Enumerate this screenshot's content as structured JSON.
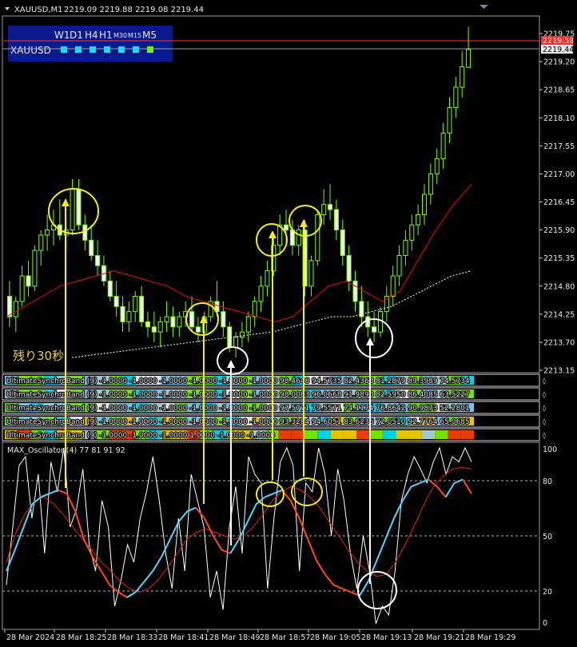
{
  "header": {
    "symbol_title": "XAUUSD,M1",
    "ohlc": "2219.09 2219.88 2219.08 2219.44"
  },
  "panel": {
    "timeframes": [
      "W1",
      "D1",
      "H4",
      "H1",
      "M30",
      "M15",
      "M5"
    ],
    "symbol": "XAUUSD",
    "squares": [
      "#00e5ff",
      "#00e5ff",
      "#00e5ff",
      "#00e5ff",
      "#00e5ff",
      "#00e5ff",
      "#66ff00"
    ]
  },
  "remaining_label": "残り30秒",
  "colors": {
    "bg": "#000000",
    "candle": "#7cfc00",
    "bid_line": "#ff3030",
    "ma_red": "#e01010",
    "ma_white": "#ffffff",
    "panel_bg": "#0a1a8c",
    "yellow": "#f2ee22",
    "osc_cyan": "#55d6ff",
    "osc_red": "#ff4a1a",
    "osc_white": "#ffffff",
    "osc_red_slow": "#e02020"
  },
  "price_axis": {
    "labels": [
      "2219.75",
      "2219.20",
      "2218.65",
      "2218.10",
      "2217.55",
      "2217.00",
      "2216.45",
      "2215.90",
      "2215.35",
      "2214.80",
      "2214.25",
      "2213.70",
      "2213.15"
    ],
    "current_price": "2219.44",
    "bid_tag": "2219.58"
  },
  "time_axis": [
    "28 Mar 2024",
    "28 Mar 18:25",
    "28 Mar 18:33",
    "28 Mar 18:41",
    "28 Mar 18:49",
    "28 Mar 18:57",
    "28 Mar 19:05",
    "28 Mar 19:13",
    "28 Mar 19:21",
    "28 Mar 19:29"
  ],
  "band_rows": [
    {
      "label": "UltimateSynchroBand (9) -1.0000 -1.0000 -1.0000 -1.0000 -1.0000 -1.0000 98.4648 94.5735 82.4368 81.2879 89.3989 74.5734"
    },
    {
      "label": "UltimateSynchroBand (9) -1.0000 -1.0000 -1.0000 -1.0000 -1.0000 -1.0000 98.0083 96.0668 91.9890 82.5950 86.4085 63.5227"
    },
    {
      "label": "UltimateSynchroBand (9) -1.0000 -1.0000 -1.0000 -1.0000 -1.0000 -1.0000 97.5771 79.5571 74.1174 76.8642 90.9873 52.2801"
    },
    {
      "label": "UltimateSynchroBand (9) -1.0000 -1.0000 -1.0000 -1.0000 -1.0000 -1.0000 93.3284 94.6051 83.6236 72.0510 92.7764 65.0685"
    },
    {
      "label": "UltimateSynchroBand (9) -1.0000 -1.0000 -1.0000 1.0000 -1.0000 -1.0000"
    }
  ],
  "oscillator": {
    "label": "MAX_Oscillator (4) 77 81 91 92",
    "axis_labels": [
      "100",
      "80",
      "50",
      "20",
      "0"
    ]
  },
  "chart_data": {
    "type": "candlestick",
    "title": "XAUUSD,M1",
    "ylim": [
      2213.15,
      2219.75
    ],
    "candles": [
      [
        2214.6,
        2214.9,
        2214.0,
        2214.2
      ],
      [
        2214.2,
        2214.6,
        2213.9,
        2214.5
      ],
      [
        2214.5,
        2215.2,
        2214.4,
        2215.0
      ],
      [
        2215.0,
        2215.3,
        2214.6,
        2214.8
      ],
      [
        2214.8,
        2215.6,
        2214.7,
        2215.5
      ],
      [
        2215.5,
        2215.9,
        2215.2,
        2215.8
      ],
      [
        2215.8,
        2216.2,
        2215.5,
        2215.9
      ],
      [
        2215.9,
        2216.3,
        2215.6,
        2216.0
      ],
      [
        2216.0,
        2216.5,
        2215.7,
        2215.8
      ],
      [
        2215.8,
        2216.1,
        2215.5,
        2215.9
      ],
      [
        2215.9,
        2216.9,
        2215.8,
        2216.7
      ],
      [
        2216.7,
        2216.9,
        2215.9,
        2216.0
      ],
      [
        2216.0,
        2216.2,
        2215.5,
        2215.7
      ],
      [
        2215.7,
        2216.0,
        2215.3,
        2215.4
      ],
      [
        2215.4,
        2215.7,
        2215.0,
        2215.2
      ],
      [
        2215.2,
        2215.4,
        2214.8,
        2214.9
      ],
      [
        2214.9,
        2215.1,
        2214.5,
        2214.6
      ],
      [
        2214.6,
        2214.9,
        2214.2,
        2214.4
      ],
      [
        2214.4,
        2214.6,
        2213.9,
        2214.1
      ],
      [
        2214.1,
        2214.5,
        2213.9,
        2214.3
      ],
      [
        2214.3,
        2214.7,
        2214.1,
        2214.6
      ],
      [
        2214.6,
        2214.8,
        2214.0,
        2214.1
      ],
      [
        2214.1,
        2214.3,
        2213.8,
        2214.0
      ],
      [
        2214.0,
        2214.3,
        2213.7,
        2213.9
      ],
      [
        2213.9,
        2214.2,
        2213.6,
        2214.1
      ],
      [
        2214.1,
        2214.5,
        2213.9,
        2214.2
      ],
      [
        2214.2,
        2214.4,
        2213.8,
        2214.0
      ],
      [
        2214.0,
        2214.3,
        2213.8,
        2214.2
      ],
      [
        2214.2,
        2214.5,
        2214.0,
        2214.3
      ],
      [
        2214.3,
        2214.6,
        2213.9,
        2214.0
      ],
      [
        2214.0,
        2214.2,
        2213.7,
        2213.9
      ],
      [
        2213.9,
        2214.3,
        2213.8,
        2214.2
      ],
      [
        2214.2,
        2214.6,
        2214.1,
        2214.5
      ],
      [
        2214.5,
        2214.9,
        2214.2,
        2214.3
      ],
      [
        2214.3,
        2214.5,
        2213.8,
        2214.0
      ],
      [
        2214.0,
        2214.1,
        2213.5,
        2213.6
      ],
      [
        2213.6,
        2213.9,
        2213.4,
        2213.8
      ],
      [
        2213.8,
        2214.1,
        2213.6,
        2213.9
      ],
      [
        2213.9,
        2214.3,
        2213.7,
        2214.2
      ],
      [
        2214.2,
        2214.6,
        2214.0,
        2214.5
      ],
      [
        2214.5,
        2215.0,
        2214.3,
        2214.8
      ],
      [
        2214.8,
        2215.3,
        2214.6,
        2215.1
      ],
      [
        2215.1,
        2215.8,
        2215.0,
        2215.6
      ],
      [
        2215.6,
        2216.2,
        2215.4,
        2216.0
      ],
      [
        2216.0,
        2216.3,
        2215.6,
        2215.9
      ],
      [
        2215.9,
        2216.1,
        2215.4,
        2215.6
      ],
      [
        2215.6,
        2216.0,
        2215.4,
        2215.9
      ],
      [
        2215.9,
        2216.1,
        2214.6,
        2214.8
      ],
      [
        2214.8,
        2215.4,
        2214.6,
        2215.3
      ],
      [
        2215.3,
        2216.3,
        2215.2,
        2216.2
      ],
      [
        2216.2,
        2216.7,
        2216.0,
        2216.4
      ],
      [
        2216.4,
        2216.8,
        2216.1,
        2216.3
      ],
      [
        2216.3,
        2216.5,
        2215.7,
        2215.9
      ],
      [
        2215.9,
        2216.1,
        2215.2,
        2215.4
      ],
      [
        2215.4,
        2215.6,
        2214.7,
        2214.9
      ],
      [
        2214.9,
        2215.1,
        2214.3,
        2214.5
      ],
      [
        2214.5,
        2214.8,
        2214.0,
        2214.2
      ],
      [
        2214.2,
        2214.5,
        2213.8,
        2214.0
      ],
      [
        2214.0,
        2214.3,
        2213.7,
        2213.9
      ],
      [
        2213.9,
        2214.4,
        2213.8,
        2214.3
      ],
      [
        2214.3,
        2214.8,
        2214.1,
        2214.6
      ],
      [
        2214.6,
        2215.2,
        2214.4,
        2215.0
      ],
      [
        2215.0,
        2215.6,
        2214.8,
        2215.4
      ],
      [
        2215.4,
        2215.9,
        2215.2,
        2215.7
      ],
      [
        2215.7,
        2216.2,
        2215.5,
        2216.0
      ],
      [
        2216.0,
        2216.4,
        2215.8,
        2216.2
      ],
      [
        2216.2,
        2216.8,
        2216.0,
        2216.6
      ],
      [
        2216.6,
        2217.2,
        2216.4,
        2217.0
      ],
      [
        2217.0,
        2217.5,
        2216.8,
        2217.3
      ],
      [
        2217.3,
        2218.0,
        2217.1,
        2217.8
      ],
      [
        2217.8,
        2218.5,
        2217.6,
        2218.3
      ],
      [
        2218.3,
        2218.9,
        2218.1,
        2218.7
      ],
      [
        2218.7,
        2219.4,
        2218.5,
        2219.1
      ],
      [
        2219.09,
        2219.88,
        2219.08,
        2219.44
      ]
    ],
    "series": [
      {
        "values": [
          2214.2,
          2214.4,
          2214.6,
          2214.8,
          2214.9,
          2215.0,
          2215.1,
          2215.0,
          2214.9,
          2214.8,
          2214.6,
          2214.5,
          2214.4,
          2214.3,
          2214.2,
          2214.1,
          2214.2,
          2214.5,
          2214.8,
          2214.9,
          2214.7,
          2214.5,
          2214.7,
          2215.3,
          2215.9,
          2216.4,
          2216.8
        ]
      },
      {
        "values": [
          2213.4,
          2213.45,
          2213.5,
          2213.55,
          2213.6,
          2213.65,
          2213.7,
          2213.75,
          2213.8,
          2213.85,
          2213.9,
          2214.0,
          2214.1,
          2214.2,
          2214.2,
          2214.3,
          2214.4,
          2214.6,
          2214.8,
          2215.0,
          2215.1
        ]
      }
    ],
    "oscillator_ylim": [
      0,
      100
    ]
  }
}
